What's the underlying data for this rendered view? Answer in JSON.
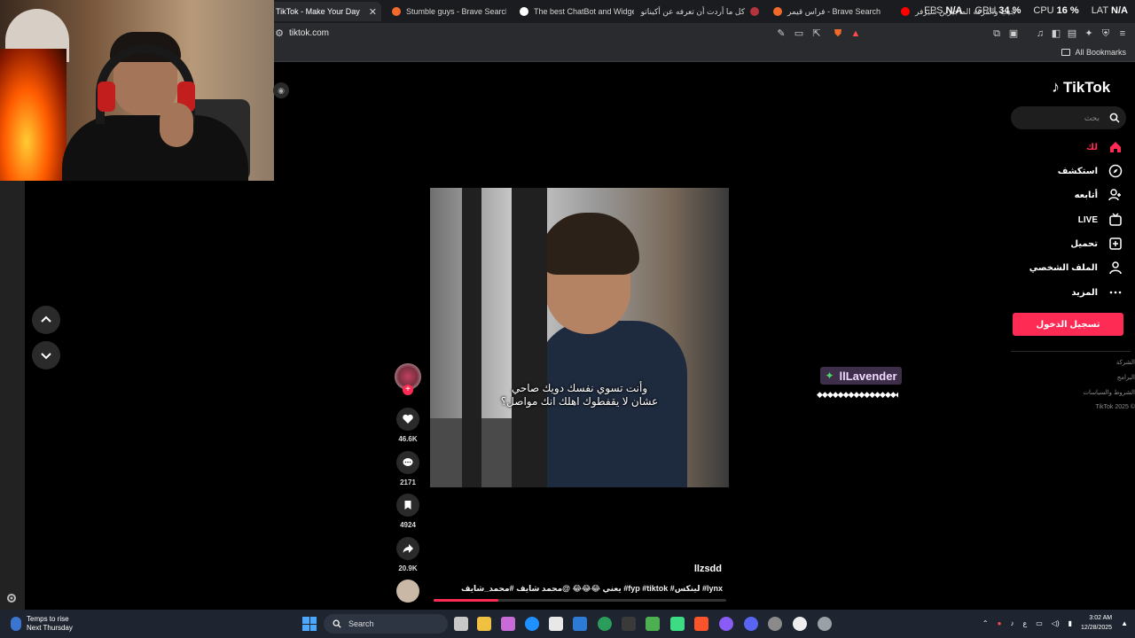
{
  "browser": {
    "tabs": [
      {
        "title": "TikTok - Make Your Day",
        "favicon_color": "#222222",
        "active": true
      },
      {
        "title": "Stumble guys - Brave Search",
        "favicon_color": "#f26a2a",
        "active": false
      },
      {
        "title": "The best ChatBot and Widgets fo",
        "favicon_color": "#ffffff",
        "active": false
      },
      {
        "title": "كل ما أردت أن تعرفه عن أكيناتور",
        "favicon_color": "#b3333f",
        "active": false
      },
      {
        "title": "فراس قيمر - Brave Search",
        "favicon_color": "#f26a2a",
        "active": false
      },
      {
        "title": "ساق الجيب والقرقة الماجيرين سيرفر",
        "favicon_color": "#ff0000",
        "active": false
      }
    ],
    "url": "tiktok.com",
    "all_bookmarks_label": "All Bookmarks",
    "perf": {
      "fps_label": "FPS",
      "fps_value": "N/A",
      "gpu_label": "GPU",
      "gpu_value": "34 %",
      "cpu_label": "CPU",
      "cpu_value": "16 %",
      "lat_label": "LAT",
      "lat_value": "N/A"
    }
  },
  "tiktok": {
    "logo_text": "TikTok",
    "search_placeholder": "بحث",
    "nav": [
      {
        "label": "لك",
        "icon": "home-icon",
        "active": true
      },
      {
        "label": "استكشف",
        "icon": "compass-icon",
        "active": false
      },
      {
        "label": "أتابعه",
        "icon": "user-plus-icon",
        "active": false
      },
      {
        "label": "LIVE",
        "icon": "live-icon",
        "active": false
      },
      {
        "label": "تحميل",
        "icon": "upload-icon",
        "active": false
      },
      {
        "label": "الملف الشخصي",
        "icon": "profile-icon",
        "active": false
      },
      {
        "label": "المزيد",
        "icon": "more-icon",
        "active": false
      }
    ],
    "login_label": "تسجيل الدخول",
    "footer": [
      "الشركة",
      "البرامج",
      "الشروط والسياسات",
      "TikTok 2025 ©"
    ],
    "accent": "#fe2c55"
  },
  "video": {
    "caption_line1": "وأنت تسوي نفسك دويك صاحي",
    "caption_line2": "عشان لا يقفطوك اهلك انك مواصل؟",
    "likes": "46.6K",
    "comments": "2171",
    "saves": "4924",
    "shares": "20.9K",
    "author": "llzsdd",
    "description": "يعني 😂😂😂 @محمد شايف #محمد_شايف #fyp #tiktok #لينكس #lynx",
    "progress_fraction": 0.22
  },
  "overlay": {
    "nametag": "llLavender",
    "deco": "◆◆◆◆◆◆◆◆◆◆◆◆◆◆◆◆◆◆◆"
  },
  "taskbar": {
    "weather_line1": "Temps to rise",
    "weather_line2": "Next Thursday",
    "search_label": "Search",
    "time": "3:02 AM",
    "date": "12/28/2025",
    "lang": "ع"
  }
}
